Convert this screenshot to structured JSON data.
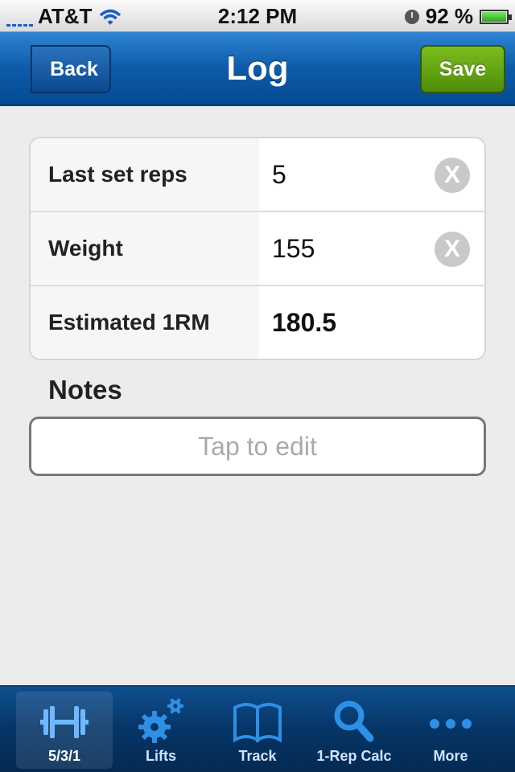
{
  "status_bar": {
    "carrier": "AT&T",
    "time": "2:12 PM",
    "battery": "92 %"
  },
  "nav": {
    "back_label": "Back",
    "title": "Log",
    "save_label": "Save"
  },
  "form": {
    "rows": [
      {
        "label": "Last set reps",
        "value": "5"
      },
      {
        "label": "Weight",
        "value": "155"
      },
      {
        "label": "Estimated 1RM",
        "value": "180.5"
      }
    ]
  },
  "notes": {
    "label": "Notes",
    "placeholder": "Tap to edit"
  },
  "tabs": [
    {
      "label": "5/3/1",
      "icon": "barbell-icon"
    },
    {
      "label": "Lifts",
      "icon": "gears-icon"
    },
    {
      "label": "Track",
      "icon": "book-icon"
    },
    {
      "label": "1-Rep Calc",
      "icon": "search-icon"
    },
    {
      "label": "More",
      "icon": "more-icon"
    }
  ],
  "colors": {
    "nav_blue": "#0d5ba8",
    "save_green": "#5c9c10",
    "tab_icon_blue": "#2d8fe6"
  }
}
